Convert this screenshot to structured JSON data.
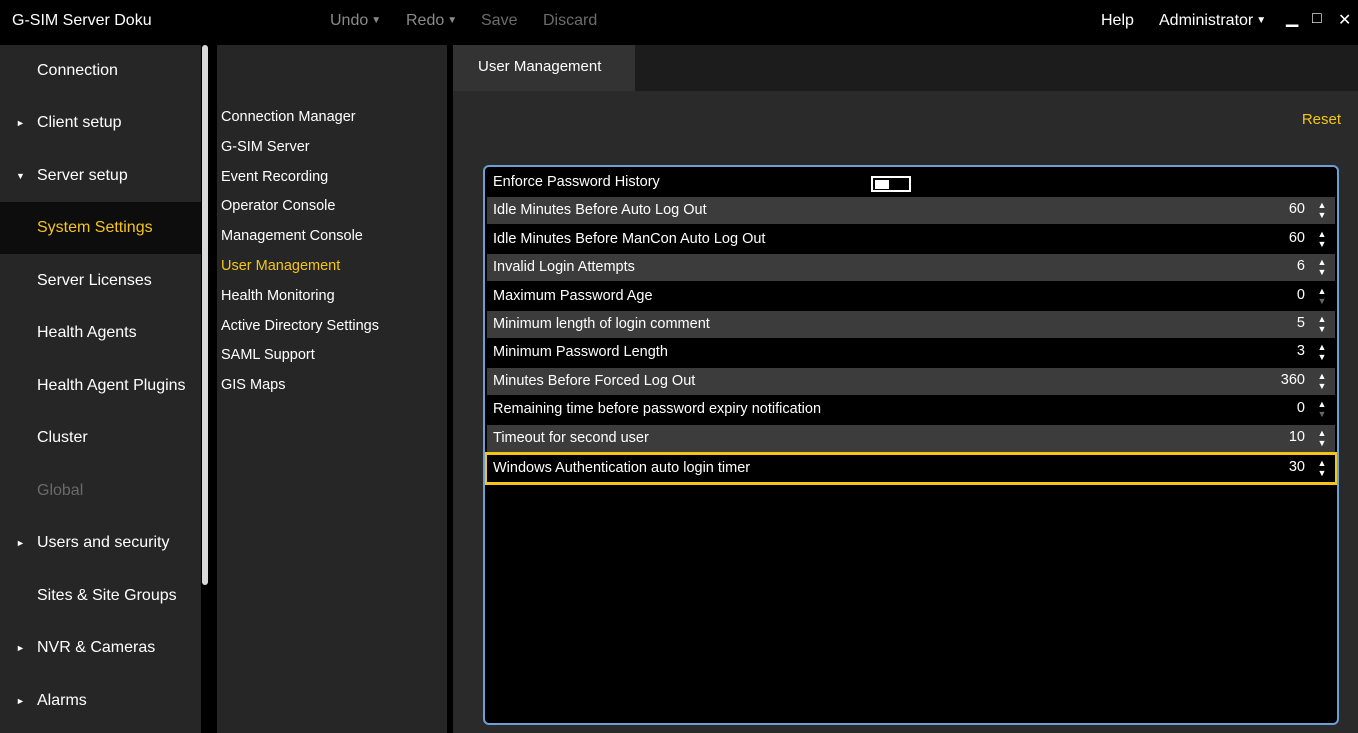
{
  "app": {
    "title": "G-SIM Server Doku"
  },
  "toolbar": {
    "undo": "Undo",
    "redo": "Redo",
    "save": "Save",
    "discard": "Discard",
    "help": "Help",
    "user": "Administrator",
    "caret": "▼",
    "minimize": "▁",
    "maximize": "□",
    "close": "✕"
  },
  "leftnav": [
    {
      "label": "Connection",
      "arrow": ""
    },
    {
      "label": "Client setup",
      "arrow": "►"
    },
    {
      "label": "Server setup",
      "arrow": "▼"
    },
    {
      "label": "System Settings",
      "arrow": ""
    },
    {
      "label": "Server Licenses",
      "arrow": ""
    },
    {
      "label": "Health Agents",
      "arrow": ""
    },
    {
      "label": "Health Agent Plugins",
      "arrow": ""
    },
    {
      "label": "Cluster",
      "arrow": ""
    },
    {
      "label": "Global",
      "arrow": ""
    },
    {
      "label": "Users and security",
      "arrow": "►"
    },
    {
      "label": "Sites & Site Groups",
      "arrow": ""
    },
    {
      "label": "NVR & Cameras",
      "arrow": "►"
    },
    {
      "label": "Alarms",
      "arrow": "►"
    }
  ],
  "subnav": [
    "Connection Manager",
    "G-SIM Server",
    "Event Recording",
    "Operator Console",
    "Management Console",
    "User Management",
    "Health Monitoring",
    "Active Directory Settings",
    "SAML Support",
    "GIS Maps"
  ],
  "main": {
    "tab": "User Management",
    "reset": "Reset",
    "rows": [
      {
        "name": "Enforce Password History",
        "value": ""
      },
      {
        "name": "Idle Minutes Before Auto Log Out",
        "value": "60"
      },
      {
        "name": "Idle Minutes Before ManCon Auto Log Out",
        "value": "60"
      },
      {
        "name": "Invalid Login Attempts",
        "value": "6"
      },
      {
        "name": "Maximum Password Age",
        "value": "0"
      },
      {
        "name": "Minimum length of login comment",
        "value": "5"
      },
      {
        "name": "Minimum Password Length",
        "value": "3"
      },
      {
        "name": "Minutes Before Forced Log Out",
        "value": "360"
      },
      {
        "name": "Remaining time before password expiry notification",
        "value": "0"
      },
      {
        "name": "Timeout for second user",
        "value": "10"
      },
      {
        "name": "Windows Authentication auto login timer",
        "value": "30"
      }
    ],
    "enforce_history_on": false,
    "spin_up": "▲",
    "spin_down": "▼"
  }
}
